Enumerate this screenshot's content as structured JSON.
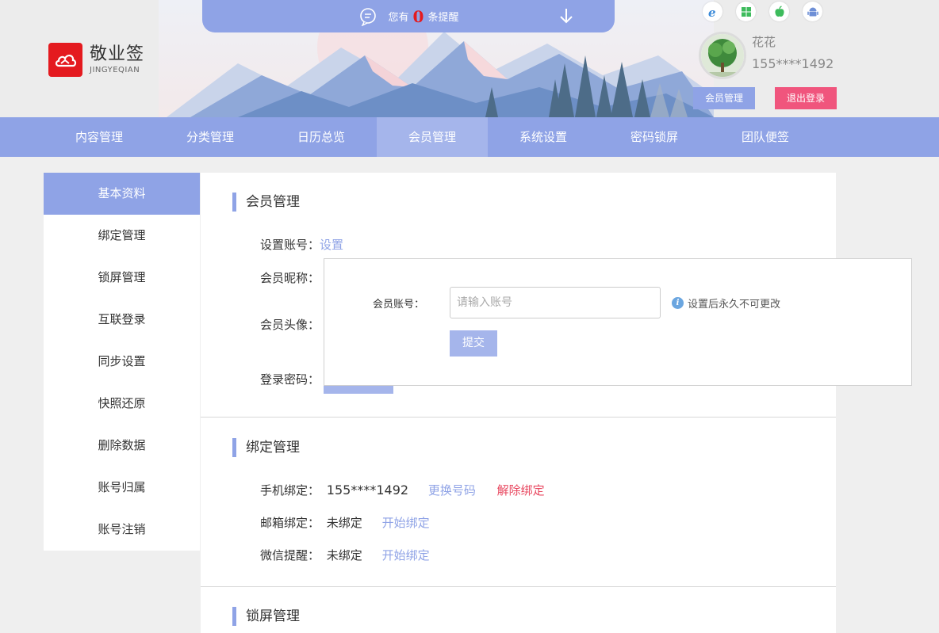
{
  "header": {
    "logo_name": "敬业签",
    "logo_sub": "JINGYEQIAN",
    "notice_prefix": "您有",
    "notice_count": "0",
    "notice_suffix": "条提醒",
    "platforms": [
      "ie-icon",
      "windows-icon",
      "apple-icon",
      "android-icon"
    ],
    "user_name": "花花",
    "user_phone": "155****1492",
    "member_btn": "会员管理",
    "logout_btn": "退出登录"
  },
  "nav": {
    "items": [
      "内容管理",
      "分类管理",
      "日历总览",
      "会员管理",
      "系统设置",
      "密码锁屏",
      "团队便签"
    ],
    "active": "会员管理"
  },
  "sidebar": {
    "items": [
      "基本资料",
      "绑定管理",
      "锁屏管理",
      "互联登录",
      "同步设置",
      "快照还原",
      "删除数据",
      "账号归属",
      "账号注销"
    ],
    "active": "基本资料"
  },
  "member": {
    "title": "会员管理",
    "account_label": "设置账号：",
    "account_link": "设置",
    "nickname_label": "会员昵称：",
    "avatar_label": "会员头像：",
    "password_label": "登录密码："
  },
  "popup": {
    "label": "会员账号：",
    "placeholder": "请输入账号",
    "tip": "设置后永久不可更改",
    "submit": "提交"
  },
  "binding": {
    "title": "绑定管理",
    "phone_label": "手机绑定：",
    "phone_value": "155****1492",
    "phone_change": "更换号码",
    "phone_unbind": "解除绑定",
    "email_label": "邮箱绑定：",
    "email_value": "未绑定",
    "email_action": "开始绑定",
    "wechat_label": "微信提醒：",
    "wechat_value": "未绑定",
    "wechat_action": "开始绑定"
  },
  "lock": {
    "title": "锁屏管理"
  },
  "colors": {
    "accent": "#8fa3e6",
    "accent_light": "#a5b5eb",
    "logout": "#f0557d",
    "logo_red": "#e41a1f",
    "danger": "#e8475f"
  }
}
